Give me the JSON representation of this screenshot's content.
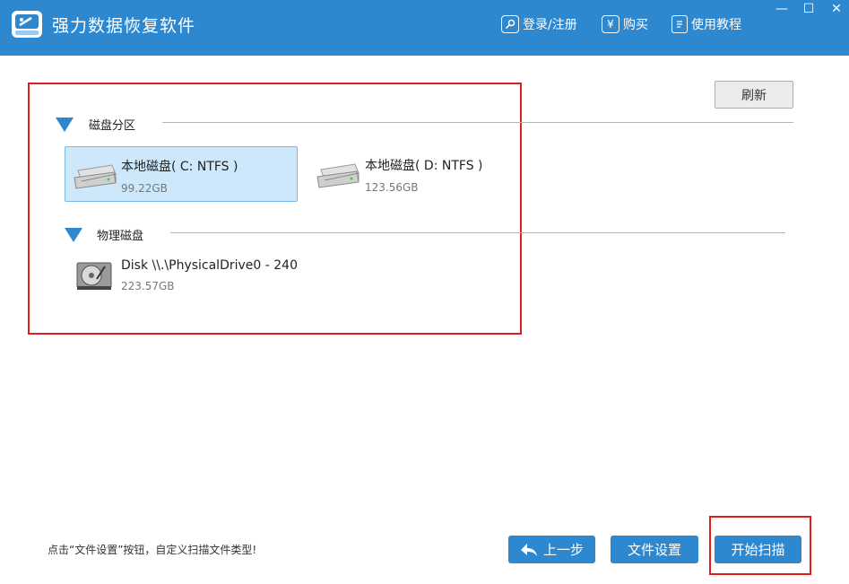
{
  "header": {
    "app_title": "强力数据恢复软件",
    "login_label": "登录/注册",
    "buy_label": "购买",
    "tutorial_label": "使用教程",
    "buy_icon_glyph": "¥",
    "window_controls": [
      "—",
      "☐",
      "✕"
    ]
  },
  "toolbar": {
    "refresh_label": "刷新"
  },
  "partitions": {
    "title": "磁盘分区",
    "drives": [
      {
        "name": "本地磁盘( C: NTFS )",
        "size": "99.22GB",
        "selected": true
      },
      {
        "name": "本地磁盘( D: NTFS )",
        "size": "123.56GB",
        "selected": false
      }
    ]
  },
  "physical": {
    "title": "物理磁盘",
    "drives": [
      {
        "name": "Disk \\\\.\\PhysicalDrive0 - 240",
        "size": "223.57GB"
      }
    ]
  },
  "footer": {
    "hint": "点击“文件设置”按钮，自定义扫描文件类型!",
    "back_label": "上一步",
    "file_settings_label": "文件设置",
    "start_scan_label": "开始扫描"
  },
  "colors": {
    "accent": "#2e88d0",
    "highlight": "#e01d1d",
    "selected_bg": "#cde8fb"
  }
}
